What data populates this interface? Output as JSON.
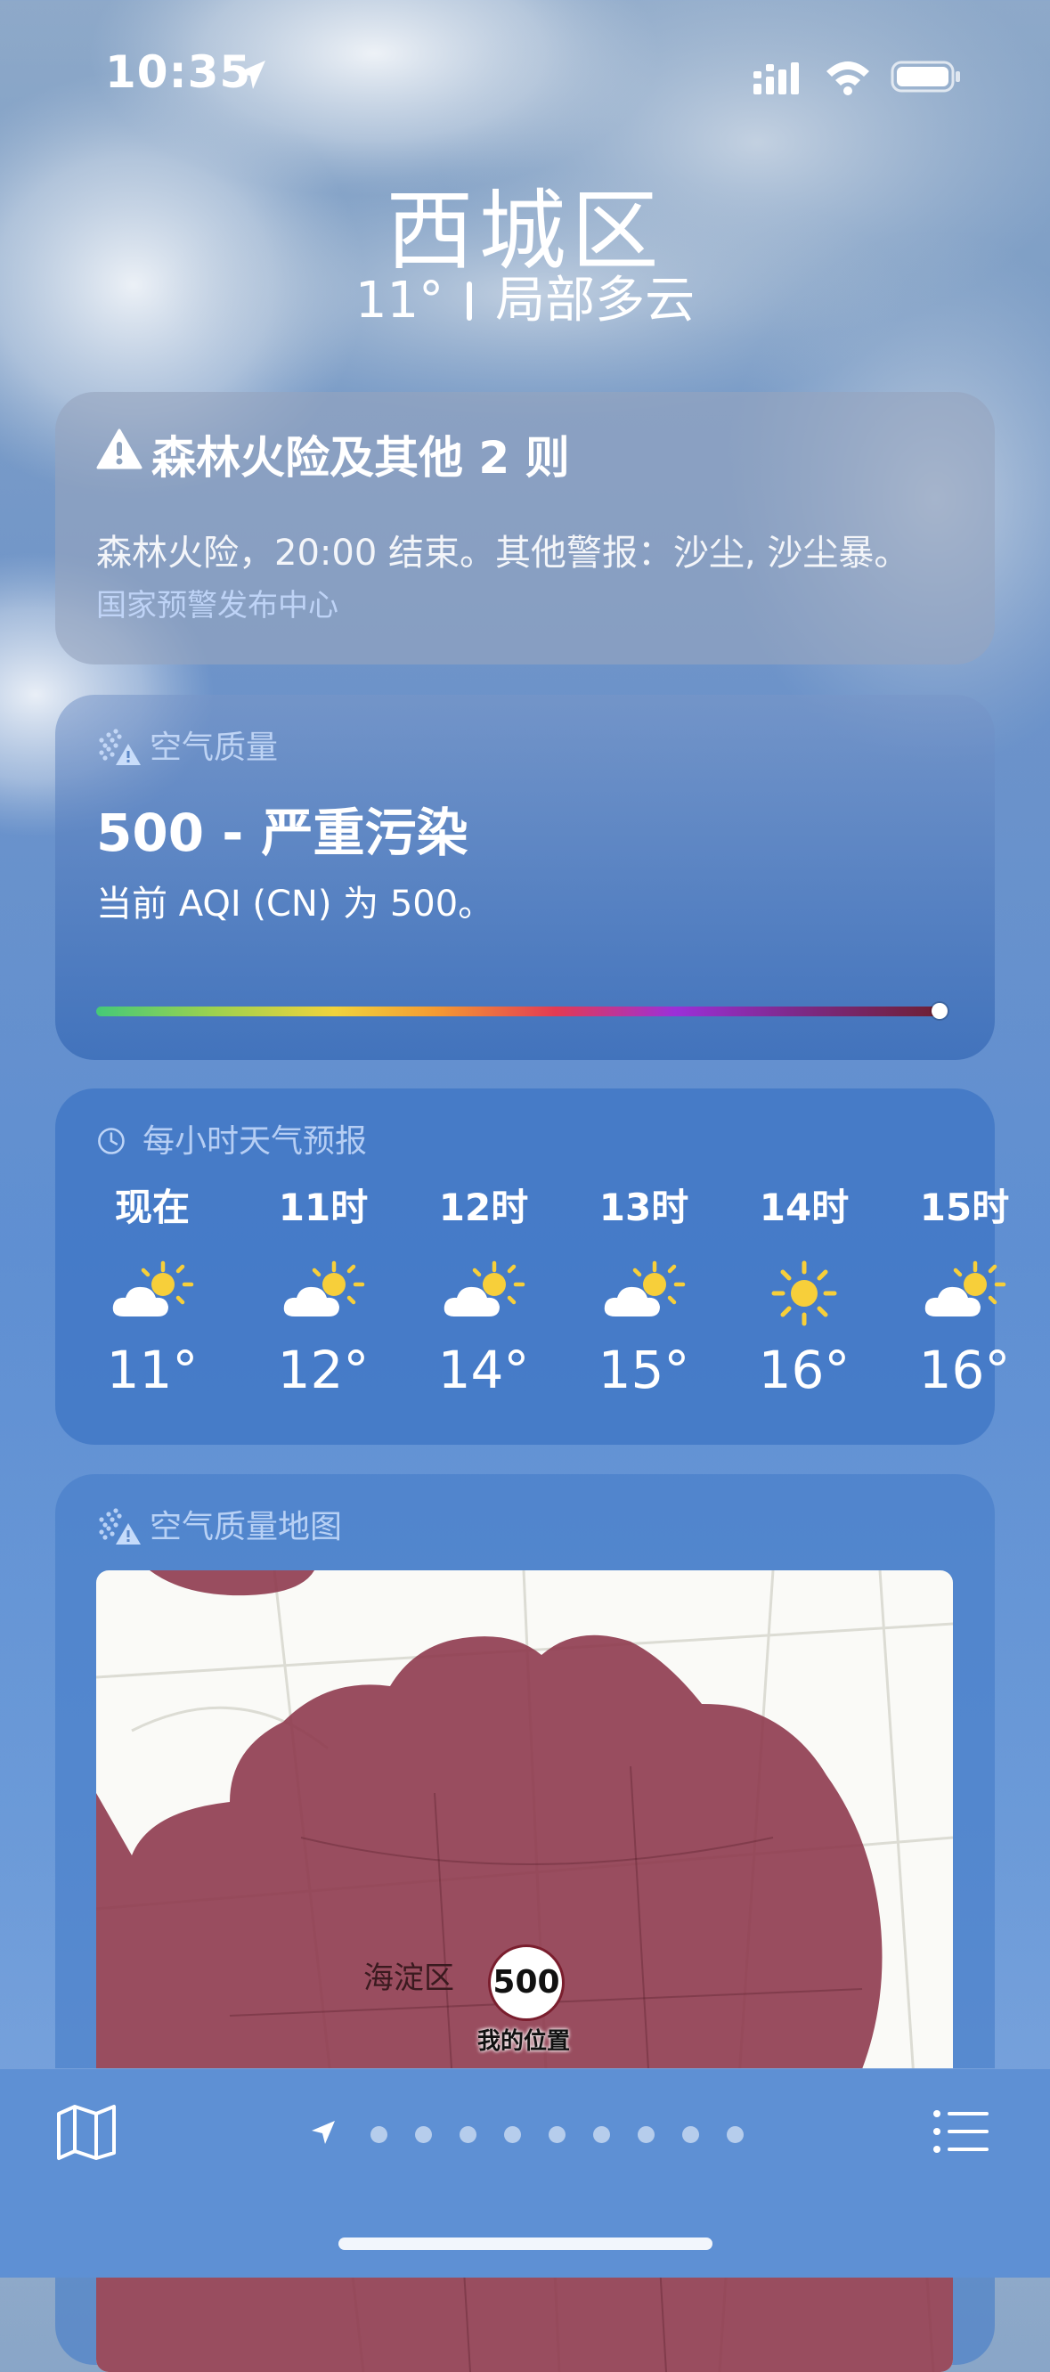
{
  "status_bar": {
    "time": "10:35"
  },
  "header": {
    "city": "西城区",
    "temperature": "11°",
    "condition": "局部多云"
  },
  "alert_card": {
    "title": "森林火险及其他 2 则",
    "body": "森林火险，20:00 结束。其他警报：沙尘, 沙尘暴。",
    "source": "国家预警发布中心"
  },
  "aqi_card": {
    "header": "空气质量",
    "value_text": "500 - 严重污染",
    "description": "当前 AQI (CN) 为 500。",
    "aqi_level_fraction": 1.0
  },
  "hourly_card": {
    "header": "每小时天气预报",
    "hours": [
      {
        "label": "现在",
        "icon": "partly-sunny-icon",
        "temp": "11°"
      },
      {
        "label": "11时",
        "icon": "partly-sunny-icon",
        "temp": "12°"
      },
      {
        "label": "12时",
        "icon": "partly-sunny-icon",
        "temp": "14°"
      },
      {
        "label": "13时",
        "icon": "partly-sunny-icon",
        "temp": "15°"
      },
      {
        "label": "14时",
        "icon": "sunny-icon",
        "temp": "16°"
      },
      {
        "label": "15时",
        "icon": "partly-sunny-icon",
        "temp": "16°"
      }
    ]
  },
  "aqi_map_card": {
    "header": "空气质量地图",
    "district_label": "海淀区",
    "pin_value": "500",
    "pin_label": "我的位置"
  },
  "colors": {
    "pollution_fill": "#8e3a4e",
    "sun": "#f7cf3a"
  },
  "toolbar": {
    "page_dot_count": 9
  }
}
